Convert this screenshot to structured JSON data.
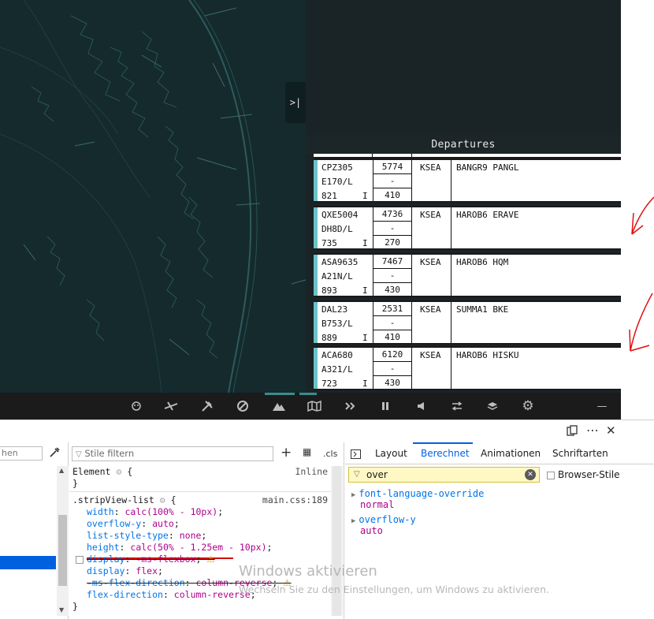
{
  "map": {
    "collapse_label": ">|"
  },
  "departures": {
    "title": "Departures",
    "strips": [
      {
        "callsign": "CPZ305",
        "type": "E170/L",
        "code": "821",
        "rules": "I",
        "squawk": "5774",
        "box2": "-",
        "altitude": "410",
        "airport": "KSEA",
        "route": "BANGR9 PANGL"
      },
      {
        "callsign": "QXE5004",
        "type": "DH8D/L",
        "code": "735",
        "rules": "I",
        "squawk": "4736",
        "box2": "-",
        "altitude": "270",
        "airport": "KSEA",
        "route": "HAROB6 ERAVE"
      },
      {
        "callsign": "ASA9635",
        "type": "A21N/L",
        "code": "893",
        "rules": "I",
        "squawk": "7467",
        "box2": "-",
        "altitude": "430",
        "airport": "KSEA",
        "route": "HAROB6 HQM"
      },
      {
        "callsign": "DAL23",
        "type": "B753/L",
        "code": "889",
        "rules": "I",
        "squawk": "2531",
        "box2": "-",
        "altitude": "410",
        "airport": "KSEA",
        "route": "SUMMA1 BKE"
      },
      {
        "callsign": "ACA680",
        "type": "A321/L",
        "code": "723",
        "rules": "I",
        "squawk": "6120",
        "box2": "-",
        "altitude": "430",
        "airport": "KSEA",
        "route": "HAROB6 HISKU"
      }
    ]
  },
  "toolbar": {
    "icons": [
      "dog-icon",
      "airplane-icon",
      "tools-icon",
      "cancel-icon",
      "mountain-icon",
      "map-icon",
      "fast-forward-icon",
      "pause-icon",
      "volume-icon",
      "swap-icon",
      "layers-icon",
      "gear-icon",
      "minimize-icon"
    ],
    "minimize_label": "—"
  },
  "devtools": {
    "left_filter_text": "hen",
    "styles_filter_placeholder": "Stile filtern",
    "cls_label": ".cls",
    "element_rule": {
      "selector": "Element",
      "brace_open": "{",
      "brace_close": "}",
      "source": "Inline"
    },
    "rule": {
      "selector": ".stripView-list",
      "source": "main.css:189",
      "declarations": [
        {
          "prop": "width",
          "value": "calc(100% - 10px)"
        },
        {
          "prop": "overflow-y",
          "value": "auto"
        },
        {
          "prop": "list-style-type",
          "value": "none"
        },
        {
          "prop": "height",
          "value": "calc(50% - 1.25em - 10px)"
        },
        {
          "prop": "display",
          "value": "-ms-flexbox"
        },
        {
          "prop": "display",
          "value": "flex"
        },
        {
          "prop": "-ms-flex-direction",
          "value": "column-reverse"
        },
        {
          "prop": "flex-direction",
          "value": "column-reverse"
        }
      ],
      "close": "}"
    },
    "tabs": [
      "Layout",
      "Berechnet",
      "Animationen",
      "Schriftarten"
    ],
    "active_tab": "Berechnet",
    "search_value": "over",
    "browser_styles_label": "Browser-Stile",
    "computed": [
      {
        "prop": "font-language-override",
        "value": "normal"
      },
      {
        "prop": "overflow-y",
        "value": "auto"
      }
    ]
  },
  "watermark": {
    "title": "Windows aktivieren",
    "subtitle": "Wechseln Sie zu den Einstellungen, um Windows zu aktivieren."
  }
}
